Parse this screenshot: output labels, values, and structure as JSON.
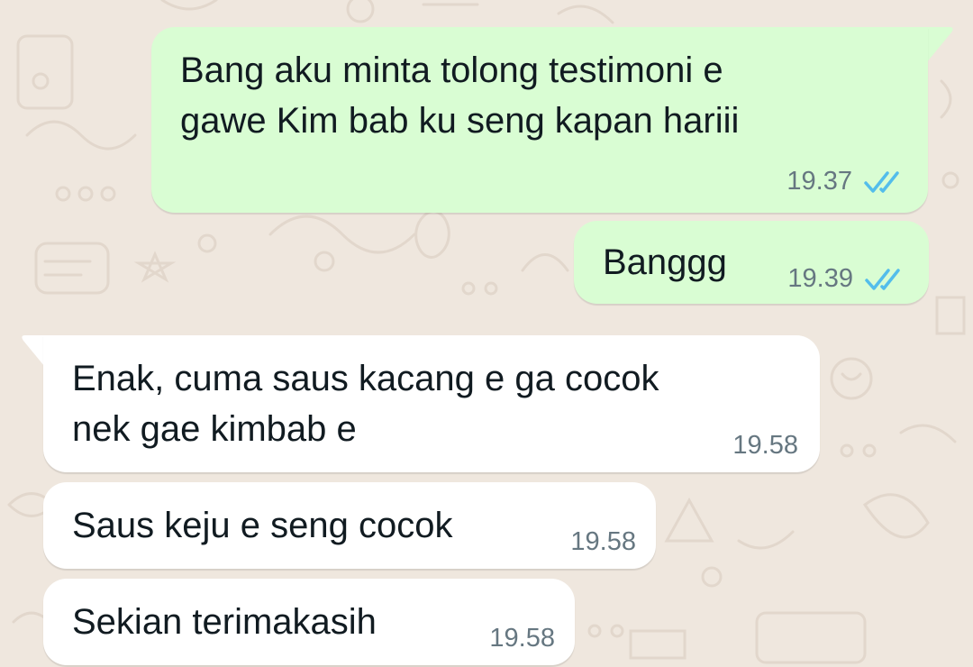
{
  "colors": {
    "wallpaper": "#efe7de",
    "outgoing_bubble": "#d9fdd3",
    "incoming_bubble": "#ffffff",
    "text": "#111b21",
    "timestamp": "#667781",
    "read_ticks": "#53bdeb"
  },
  "messages": [
    {
      "direction": "outgoing",
      "text": "Bang aku minta tolong testimoni e\ngawe Kim bab ku seng kapan hariii",
      "time": "19.37",
      "status_icon": "double-check-read-icon"
    },
    {
      "direction": "outgoing",
      "text": "Banggg",
      "time": "19.39",
      "status_icon": "double-check-read-icon"
    },
    {
      "direction": "incoming",
      "text": "Enak, cuma saus kacang e ga cocok\nnek gae kimbab e",
      "time": "19.58"
    },
    {
      "direction": "incoming",
      "text": "Saus keju e seng cocok",
      "time": "19.58"
    },
    {
      "direction": "incoming",
      "text": "Sekian terimakasih",
      "time": "19.58"
    }
  ]
}
